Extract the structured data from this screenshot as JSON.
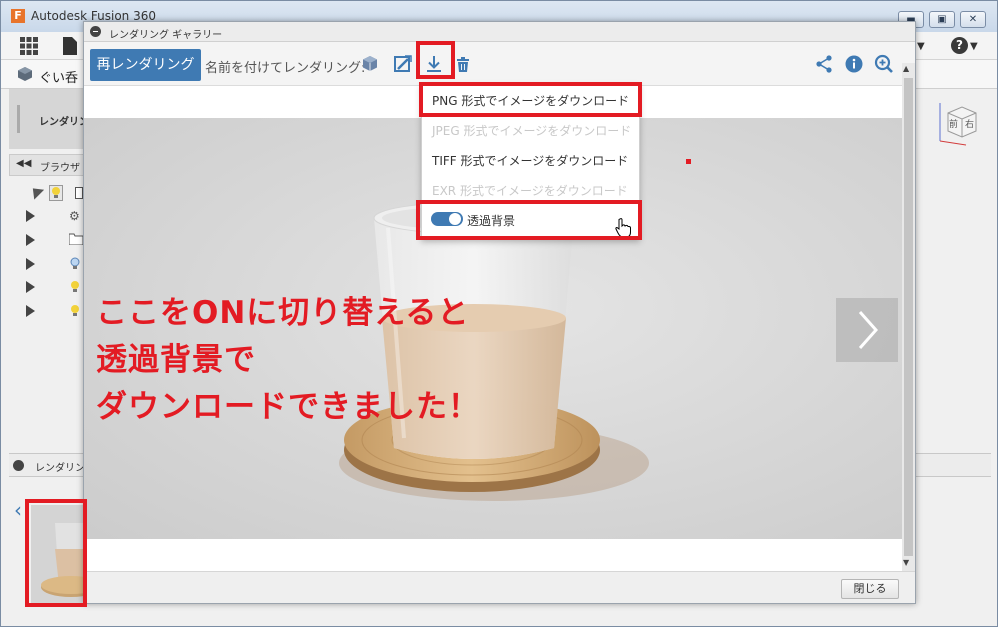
{
  "app": {
    "title": "Autodesk Fusion 360",
    "logo_letter": "F",
    "window_controls": [
      "▬",
      "▣",
      "✕"
    ],
    "doc_tab_label": "ぐい呑",
    "ribbon_label": "レンダリング",
    "browser_label": "ブラウザ",
    "render_strip_label": "レンダリング",
    "help_label": "?",
    "viewcube_labels": [
      "前",
      "右"
    ]
  },
  "gallery": {
    "title": "レンダリング ギャラリー",
    "rerender_label": "再レンダリング",
    "named_render_label": "名前を付けてレンダリング:",
    "close_label": "閉じる"
  },
  "download_menu": {
    "items": [
      {
        "label": "PNG 形式でイメージをダウンロード",
        "enabled": true
      },
      {
        "label": "JPEG 形式でイメージをダウンロード",
        "enabled": false
      },
      {
        "label": "TIFF 形式でイメージをダウンロード",
        "enabled": true
      },
      {
        "label": "EXR 形式でイメージをダウンロード",
        "enabled": false
      }
    ],
    "transparent_bg_label": "透過背景",
    "transparent_bg_on": true
  },
  "annotation": {
    "text": "ここをONに切り替えると\n透過背景で\nダウンロードできました！"
  },
  "colors": {
    "accent": "#3f7ab3",
    "highlight": "#e31b23"
  }
}
